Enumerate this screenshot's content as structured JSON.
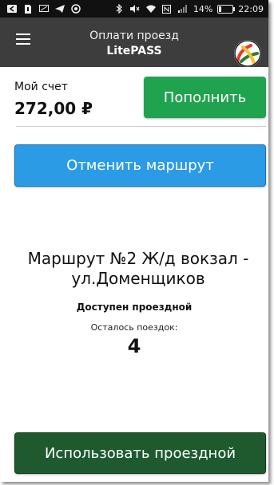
{
  "status_bar": {
    "battery": "14%",
    "time": "22:09",
    "left_icons": [
      "back-icon",
      "sim-icon",
      "sms-icon",
      "telegram-icon",
      "chrome-icon"
    ],
    "right_icons": [
      "bluetooth-icon",
      "mute-icon",
      "wifi-icon",
      "nfc-icon",
      "signal-icon",
      "battery-icon"
    ]
  },
  "app_bar": {
    "title_line1": "Оплати проезд",
    "title_line2": "LitePASS",
    "menu_icon": "menu-icon",
    "logo_icon": "app-logo-icon"
  },
  "account": {
    "label": "Мой счет",
    "balance": "272,00 ₽",
    "topup_label": "Пополнить"
  },
  "actions": {
    "cancel_route_label": "Отменить маршрут",
    "use_pass_label": "Использовать проездной"
  },
  "route": {
    "name": "Маршрут №2 Ж/д вокзал - ул.Доменщиков",
    "pass_status": "Доступен проездной",
    "trips_left_label": "Осталось поездок:",
    "trips_left_count": "4"
  },
  "colors": {
    "status_bar": "#111111",
    "app_bar": "#3d3d3d",
    "topup_button": "#1fa34f",
    "cancel_button": "#2b9be5",
    "use_button": "#1e5a2e"
  }
}
